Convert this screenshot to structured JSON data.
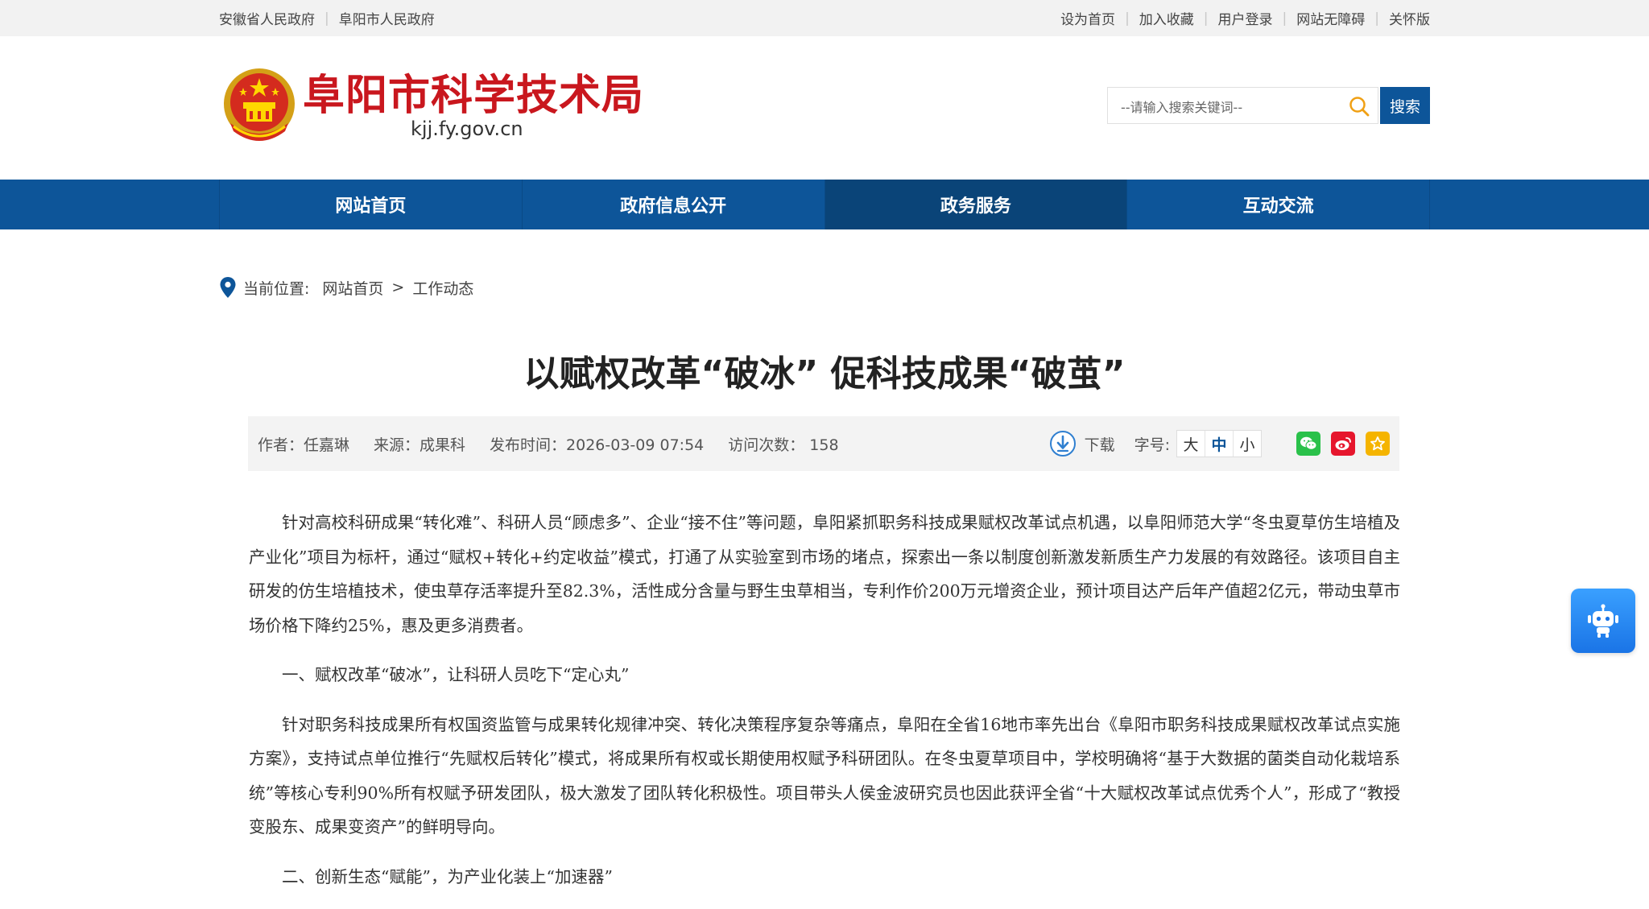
{
  "topbar": {
    "left_links": [
      "安徽省人民政府",
      "阜阳市人民政府"
    ],
    "right_links": [
      "设为首页",
      "加入收藏",
      "用户登录",
      "网站无障碍",
      "关怀版"
    ]
  },
  "header": {
    "site_title": "阜阳市科学技术局",
    "site_domain": "kjj.fy.gov.cn",
    "search_placeholder": "--请输入搜索关键词--",
    "search_button": "搜索"
  },
  "nav": {
    "items": [
      "网站首页",
      "政府信息公开",
      "政务服务",
      "互动交流"
    ],
    "active_index": 2
  },
  "breadcrumb": {
    "label": "当前位置:",
    "items": [
      "网站首页",
      "工作动态"
    ],
    "separator": ">"
  },
  "article": {
    "title": "以赋权改革“破冰” 促科技成果“破茧”",
    "meta": {
      "author": "作者：任嘉琳",
      "source": "来源：成果科",
      "publish_time": "发布时间：2026-03-09 07:54",
      "visits": "访问次数： 158",
      "download_label": "下载",
      "font_size_label": "字号:",
      "font_sizes": [
        "大",
        "中",
        "小"
      ],
      "font_size_selected": "中"
    },
    "share_icons": [
      "wechat-icon",
      "weibo-icon",
      "favorite-icon"
    ],
    "paragraphs": [
      "针对高校科研成果“转化难”、科研人员“顾虑多”、企业“接不住”等问题，阜阳紧抓职务科技成果赋权改革试点机遇，以阜阳师范大学“冬虫夏草仿生培植及产业化”项目为标杆，通过“赋权+转化+约定收益”模式，打通了从实验室到市场的堵点，探索出一条以制度创新激发新质生产力发展的有效路径。该项目自主研发的仿生培植技术，使虫草存活率提升至82.3%，活性成分含量与野生虫草相当，专利作价200万元增资企业，预计项目达产后年产值超2亿元，带动虫草市场价格下降约25%，惠及更多消费者。",
      "一、赋权改革“破冰”，让科研人员吃下“定心丸”",
      "针对职务科技成果所有权国资监管与成果转化规律冲突、转化决策程序复杂等痛点，阜阳在全省16地市率先出台《阜阳市职务科技成果赋权改革试点实施方案》，支持试点单位推行“先赋权后转化”模式，将成果所有权或长期使用权赋予科研团队。在冬虫夏草项目中，学校明确将“基于大数据的菌类自动化栽培系统”等核心专利90%所有权赋予研发团队，极大激发了团队转化积极性。项目带头人侯金波研究员也因此获评全省“十大赋权改革试点优秀个人”，形成了“教授变股东、成果变资产”的鲜明导向。",
      "二、创新生态“赋能”，为产业化装上“加速器”"
    ]
  },
  "colors": {
    "brand_blue": "#0d5599",
    "title_red": "#c9171e",
    "wechat_green": "#2ac14a",
    "weibo_red": "#e6162d",
    "favorite_yellow": "#f5b400"
  },
  "floating": {
    "robot_icon": "robot-icon"
  }
}
